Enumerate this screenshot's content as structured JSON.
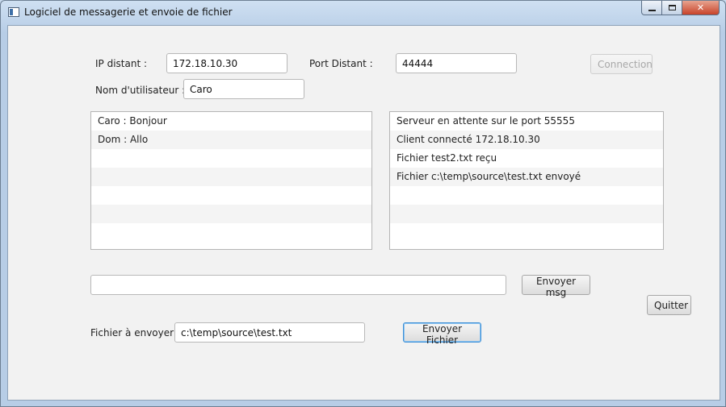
{
  "window": {
    "title": "Logiciel de messagerie et envoie de fichier"
  },
  "connection": {
    "ip_label": "IP distant :",
    "ip_value": "172.18.10.30",
    "port_label": "Port Distant :",
    "port_value": "44444",
    "connect_label": "Connection",
    "user_label": "Nom d'utilisateur :",
    "user_value": "Caro"
  },
  "chat": {
    "messages": [
      "Caro : Bonjour",
      "Dom : Allo",
      "",
      "",
      "",
      "",
      ""
    ],
    "input_value": "",
    "send_label": "Envoyer msg"
  },
  "log": {
    "entries": [
      "Serveur en attente sur le port 55555",
      "Client connecté 172.18.10.30",
      "Fichier test2.txt reçu",
      "Fichier c:\\temp\\source\\test.txt  envoyé",
      "",
      "",
      ""
    ]
  },
  "quit_label": "Quitter",
  "file": {
    "label": "Fichier à envoyer :",
    "path_value": "c:\\temp\\source\\test.txt",
    "send_label": "Envoyer Fichier"
  }
}
